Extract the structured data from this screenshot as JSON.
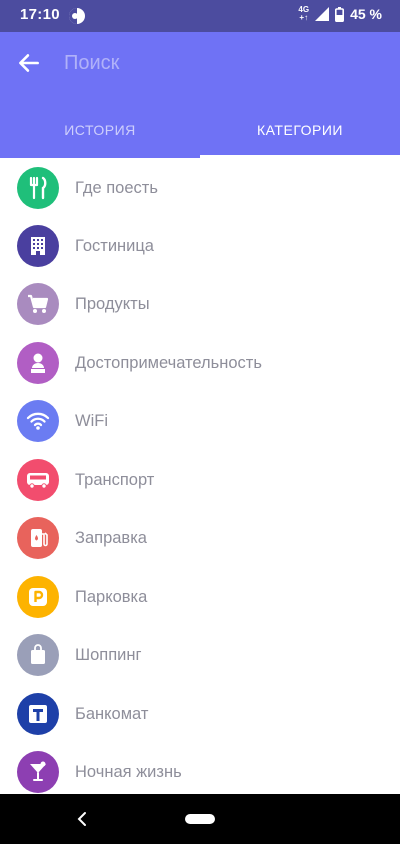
{
  "status_bar": {
    "time": "17:10",
    "network_top": "4G",
    "network_bottom": "+↑",
    "battery": "45 %"
  },
  "header": {
    "search_placeholder": "Поиск"
  },
  "tabs": [
    {
      "label": "ИСТОРИЯ",
      "active": false
    },
    {
      "label": "КАТЕГОРИИ",
      "active": true
    }
  ],
  "categories": [
    {
      "label": "Где поесть",
      "icon": "fork-knife-icon",
      "color": "#1fbf7a"
    },
    {
      "label": "Гостиница",
      "icon": "hotel-building-icon",
      "color": "#4a3f9f"
    },
    {
      "label": "Продукты",
      "icon": "shopping-cart-icon",
      "color": "#a98bbf"
    },
    {
      "label": "Достопримечательность",
      "icon": "monument-icon",
      "color": "#b15ec4"
    },
    {
      "label": "WiFi",
      "icon": "wifi-icon",
      "color": "#6b7cf2"
    },
    {
      "label": "Транспорт",
      "icon": "bus-icon",
      "color": "#f24d6e"
    },
    {
      "label": "Заправка",
      "icon": "gas-station-icon",
      "color": "#e8635c"
    },
    {
      "label": "Парковка",
      "icon": "parking-icon",
      "color": "#fdb300"
    },
    {
      "label": "Шоппинг",
      "icon": "shopping-bag-icon",
      "color": "#9a9fb8"
    },
    {
      "label": "Банкомат",
      "icon": "atm-icon",
      "color": "#1e40a8"
    },
    {
      "label": "Ночная жизнь",
      "icon": "cocktail-icon",
      "color": "#8d3fb2"
    }
  ],
  "theme": {
    "header": "#6f72f5",
    "status_bar": "#4c4c9f"
  }
}
